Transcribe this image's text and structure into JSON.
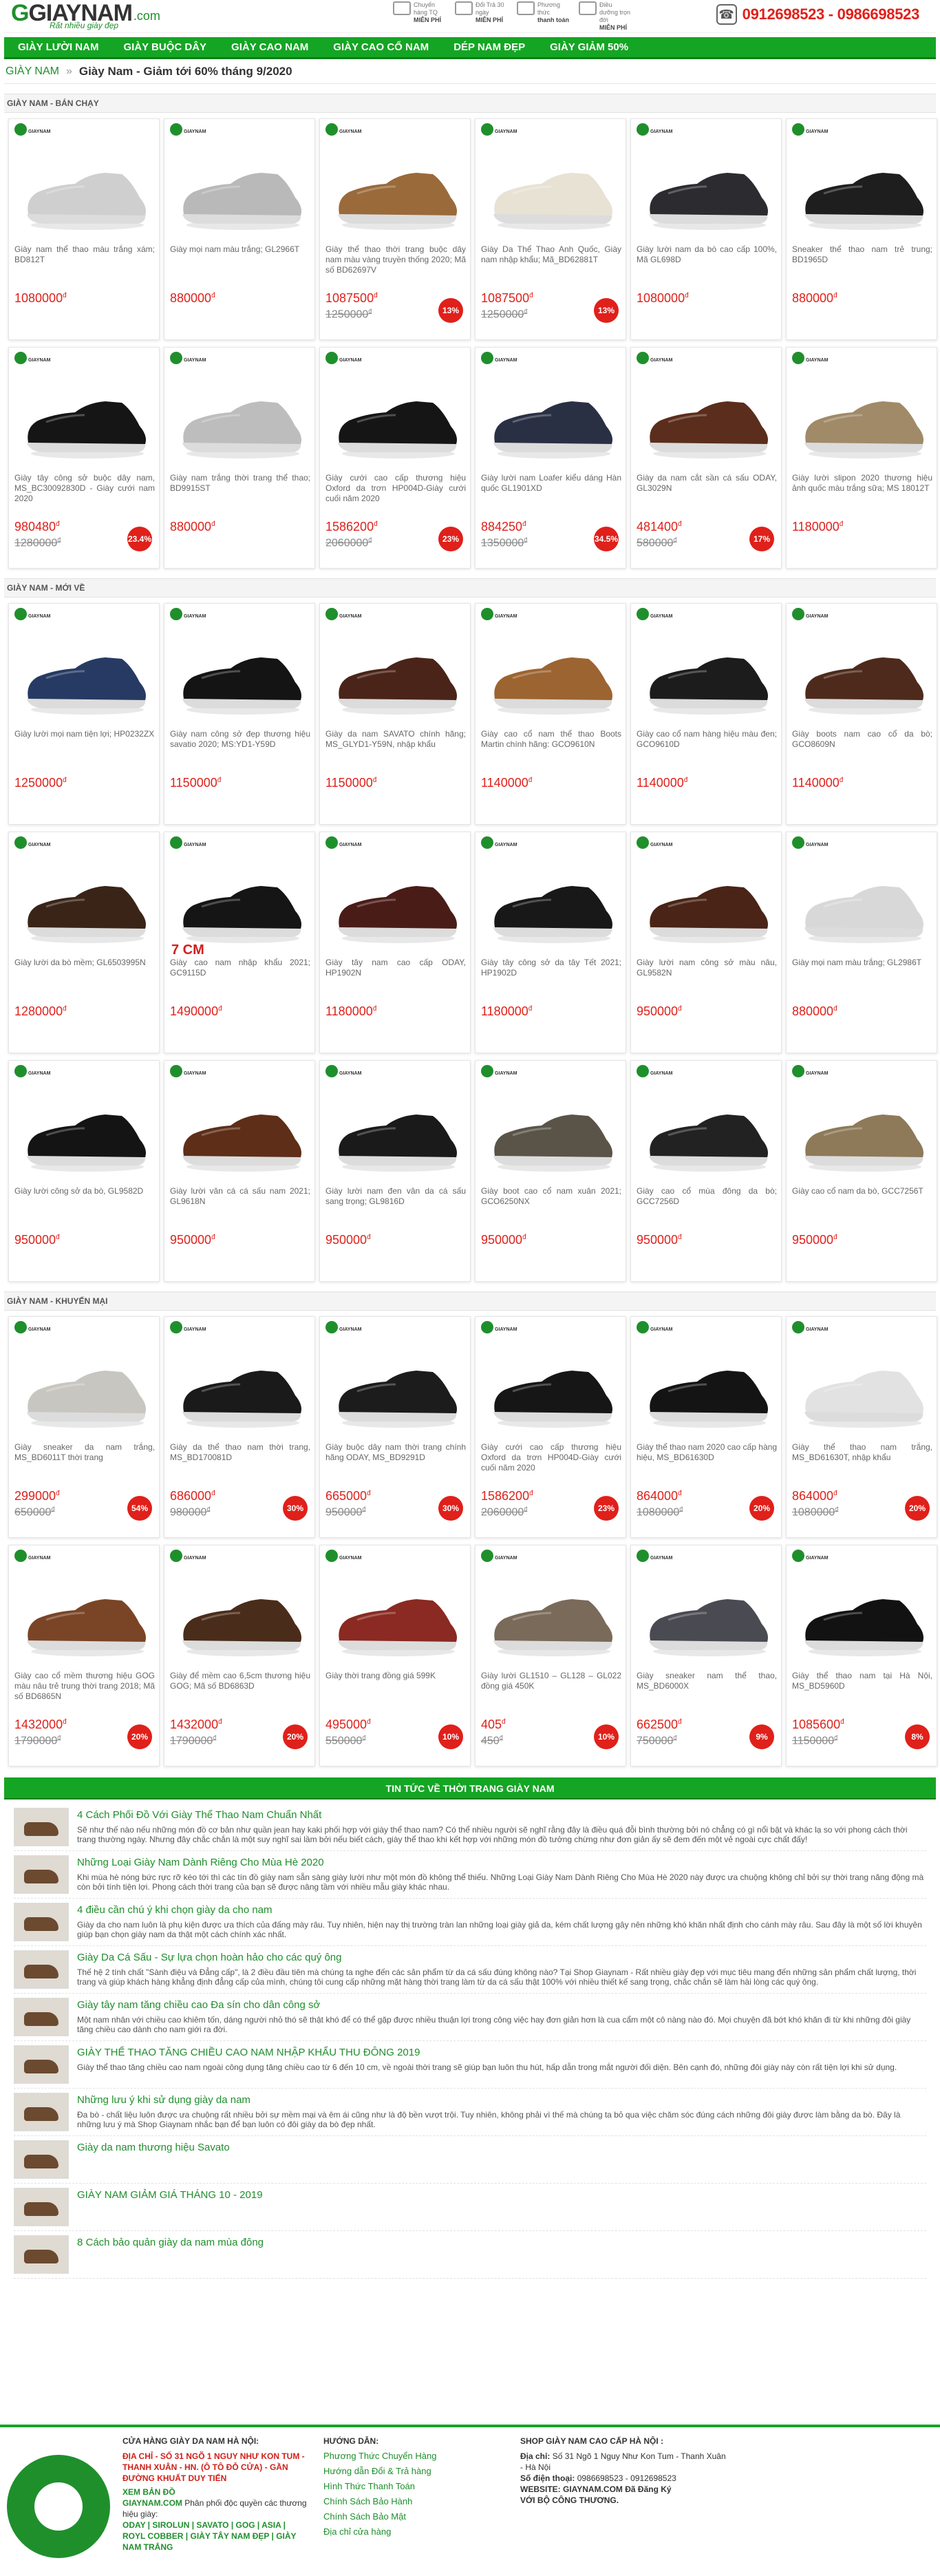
{
  "header": {
    "logo": "GIAYNAM",
    "logo_suffix": ".com",
    "slogan": "Rất nhiều giày đẹp",
    "services": [
      {
        "label": "Chuyển hàng TQ",
        "value": "MIỄN PHÍ"
      },
      {
        "label": "Đổi Trả 30 ngày",
        "value": "MIỄN PHÍ"
      },
      {
        "label": "Phương thức",
        "value": "thanh toán"
      },
      {
        "label": "Điều dưỡng trọn đời",
        "value": "MIỄN PHÍ"
      }
    ],
    "hotline": "0912698523 - 0986698523"
  },
  "nav": [
    "GIÀY LƯỜI NAM",
    "GIÀY BUỘC DÂY",
    "GIÀY CAO NAM",
    "GIÀY CAO CỔ NAM",
    "DÉP NAM ĐẸP",
    "GIÀY GIẢM 50%"
  ],
  "breadcrumb": {
    "home": "GIÀY NAM",
    "sep": "»",
    "current": "Giày Nam - Giảm tới 60% tháng 9/2020"
  },
  "sections": [
    {
      "title": "GIÀY NAM - BÁN CHẠY",
      "products": [
        {
          "name": "Giày nam thể thao màu trắng xám; BD812T",
          "price": "1080000",
          "color": "#cfcfcf"
        },
        {
          "name": "Giày mọi nam màu trắng; GL2966T",
          "price": "880000",
          "color": "#b9b9b9"
        },
        {
          "name": "Giày thể thao thời trang buộc dây nam màu vàng truyền thống 2020; Mã số BD62697V",
          "price": "1087500",
          "old": "1250000",
          "badge": "13%",
          "color": "#9a6a3a"
        },
        {
          "name": "Giày Da Thể Thao Anh Quốc, Giày nam nhập khẩu; Mã_BD62881T",
          "price": "1087500",
          "old": "1250000",
          "badge": "13%",
          "color": "#e8e2d4"
        },
        {
          "name": "Giày lười nam da bò cao cấp 100%, Mã GL698D",
          "price": "1080000",
          "color": "#2b2b30"
        },
        {
          "name": "Sneaker thể thao nam trẻ trung; BD1965D",
          "price": "880000",
          "color": "#1e1e1e"
        },
        {
          "name": "Giày tây công sở buộc dây nam, MS_BC30092830D - Giày cưới nam 2020",
          "price": "980480",
          "old": "1280000",
          "badge": "23.4%",
          "color": "#151515"
        },
        {
          "name": "Giày nam trắng thời trang thể thao; BD9915ST",
          "price": "880000",
          "color": "#bdbdbd"
        },
        {
          "name": "Giày cưới cao cấp thương hiệu Oxford da trơn HP004D-Giày cưới cuối năm 2020",
          "price": "1586200",
          "old": "2060000",
          "badge": "23%",
          "color": "#151515"
        },
        {
          "name": "Giày lười nam Loafer kiểu dáng Hàn quốc GL1901XD",
          "price": "884250",
          "old": "1350000",
          "badge": "34.5%",
          "color": "#2a3044"
        },
        {
          "name": "Giày da nam cắt sần cá sấu ODAY, GL3029N",
          "price": "481400",
          "old": "580000",
          "badge": "17%",
          "color": "#5b2d1c"
        },
        {
          "name": "Giày lười slipon 2020 thương hiệu ảnh quốc màu trắng sữa; MS 18012T",
          "price": "1180000",
          "color": "#a08a68"
        }
      ]
    },
    {
      "title": "GIÀY NAM - MỚI VỀ",
      "products": [
        {
          "name": "Giày lười mọi nam tiện lợi; HP0232ZX",
          "price": "1250000",
          "color": "#263a63"
        },
        {
          "name": "Giày nam công sở đẹp thương hiệu savatio 2020; MS:YD1-Y59D",
          "price": "1150000",
          "color": "#141414"
        },
        {
          "name": "Giày da nam SAVATO chính hãng; MS_GLYD1-Y59N, nhập khẩu",
          "price": "1150000",
          "color": "#4a2418"
        },
        {
          "name": "Giày cao cổ nam thể thao Boots Martin chính hãng: GCO9610N",
          "price": "1140000",
          "color": "#9c6430"
        },
        {
          "name": "Giày cao cổ nam hàng hiệu màu đen; GCO9610D",
          "price": "1140000",
          "color": "#1c1c1c"
        },
        {
          "name": "Giày boots nam cao cổ da bò; GCO8609N",
          "price": "1140000",
          "color": "#4e2a1c"
        },
        {
          "name": "Giày lười da bò mềm; GL6503995N",
          "price": "1280000",
          "color": "#3a2418"
        },
        {
          "name": "Giày cao nam nhập khẩu 2021; GC9115D",
          "price": "1490000",
          "promo": "7 CM",
          "color": "#151515"
        },
        {
          "name": "Giày tây nam cao cấp ODAY, HP1902N",
          "price": "1180000",
          "color": "#4a1c18"
        },
        {
          "name": "Giày tây công sở da tây Tết 2021; HP1902D",
          "price": "1180000",
          "color": "#181818"
        },
        {
          "name": "Giày lười nam công sở màu nâu, GL9582N",
          "price": "950000",
          "color": "#4a2416"
        },
        {
          "name": "Giày mọi nam màu trắng; GL2986T",
          "price": "880000",
          "color": "#d8d8d8"
        },
        {
          "name": "Giày lười công sở da bò, GL9582D",
          "price": "950000",
          "color": "#141414"
        },
        {
          "name": "Giày lười vân cá cá sấu nam 2021; GL9618N",
          "price": "950000",
          "color": "#5e2e18"
        },
        {
          "name": "Giày lười nam đen vân da cá sấu sang trọng; GL9816D",
          "price": "950000",
          "color": "#1a1a1a"
        },
        {
          "name": "Giày boot cao cổ nam xuân 2021; GCO6250NX",
          "price": "950000",
          "color": "#5a5448"
        },
        {
          "name": "Giày cao cổ mùa đông da bò; GCC7256D",
          "price": "950000",
          "color": "#222222"
        },
        {
          "name": "Giày cao cổ nam da bò, GCC7256T",
          "price": "950000",
          "color": "#8e7a58"
        }
      ]
    },
    {
      "title": "GIÀY NAM - KHUYẾN MẠI",
      "products": [
        {
          "name": "Giày sneaker da nam trắng, MS_BD6011T thời trang",
          "price": "299000",
          "old": "650000",
          "badge": "54%",
          "color": "#c8c6c0"
        },
        {
          "name": "Giày da thể thao nam thời trang, MS_BD170081D",
          "price": "686000",
          "old": "980000",
          "badge": "30%",
          "color": "#1a1a1a"
        },
        {
          "name": "Giày buộc dây nam thời trang chính hãng ODAY, MS_BD9291D",
          "price": "665000",
          "old": "950000",
          "badge": "30%",
          "color": "#1c1c1c"
        },
        {
          "name": "Giày cưới cao cấp thương hiệu Oxford da trơn HP004D-Giày cưới cuối năm 2020",
          "price": "1586200",
          "old": "2060000",
          "badge": "23%",
          "color": "#161616"
        },
        {
          "name": "Giày thể thao nam 2020 cao cấp hàng hiệu, MS_BD61630D",
          "price": "864000",
          "old": "1080000",
          "badge": "20%",
          "color": "#141414"
        },
        {
          "name": "Giày thể thao nam trắng, MS_BD61630T, nhập khẩu",
          "price": "864000",
          "old": "1080000",
          "badge": "20%",
          "color": "#e2e2e2"
        },
        {
          "name": "Giày cao cổ mềm thương hiệu GOG màu nâu trẻ trung thời trang 2018; Mã số BD6865N",
          "price": "1432000",
          "old": "1790000",
          "badge": "20%",
          "color": "#7a4526"
        },
        {
          "name": "Giày để mềm cao 6,5cm thương hiệu GOG; Mã số BD6863D",
          "price": "1432000",
          "old": "1790000",
          "badge": "20%",
          "color": "#4a2c1a"
        },
        {
          "name": "Giày thời trang đồng giá 599K",
          "price": "495000",
          "old": "550000",
          "badge": "10%",
          "color": "#8a2a22"
        },
        {
          "name": "Giày lười GL1510 – GL128 – GL022 đồng giá 450K",
          "price": "405",
          "old": "450",
          "badge": "10%",
          "color": "#7a6a5a"
        },
        {
          "name": "Giày sneaker nam thể thao, MS_BD6000X",
          "price": "662500",
          "old": "750000",
          "badge": "9%",
          "color": "#4a4a52"
        },
        {
          "name": "Giày thể thao nam tại Hà Nội, MS_BD5960D",
          "price": "1085600",
          "old": "1150000",
          "badge": "8%",
          "color": "#121212"
        }
      ]
    }
  ],
  "news": {
    "title": "TIN TỨC VỀ THỜI TRANG GIÀY NAM",
    "items": [
      {
        "title": "4 Cách Phối Đồ Với Giày Thể Thao Nam Chuẩn Nhất",
        "desc": "Sẽ như thế nào nếu những món đồ cơ bản như quần jean hay kaki phối hợp với giày thể thao nam? Có thể nhiều người sẽ nghĩ rằng đây là điều quá đỗi bình thường bởi nó chẳng có gì nổi bật và khác lạ so với phong cách thời trang thường ngày. Nhưng đây chắc chắn là một suy nghĩ sai lầm bởi nếu biết cách, giày thể thao khi kết hợp với những món đồ tưởng chừng như đơn giản ấy sẽ đem đến một vẻ ngoài cực chất đấy!"
      },
      {
        "title": "Những Loại Giày Nam Dành Riêng Cho Mùa Hè 2020",
        "desc": "Khi mùa hè nóng bức rực rỡ kéo tới thì các tín đồ giày nam sẵn sàng giày lười như một món đồ không thể thiếu. Những Loại Giày Nam Dành Riêng Cho Mùa Hè 2020 này được ưa chuộng không chỉ bởi sự thời trang năng động mà còn bởi tính tiện lợi. Phong cách thời trang của bạn sẽ được nâng tầm với nhiều mẫu giày khác nhau."
      },
      {
        "title": "4 điều cần chú ý khi chọn giày da cho nam",
        "desc": "Giày da cho nam luôn là phụ kiện được ưa thích của đấng mày râu. Tuy nhiên, hiện nay thị trường tràn lan những loại giày giả da, kém chất lượng gây nên những khó khăn nhất định cho cánh mày râu. Sau đây là một số lời khuyên giúp bạn chọn giày nam da thật một cách chính xác nhất."
      },
      {
        "title": "Giày Da Cá Sấu - Sự lựa chọn hoàn hảo cho các quý ông",
        "desc": "Thế hệ 2 tính chất \"Sành điệu và Đẳng cấp\", là 2 điều đầu tiên mà chúng ta nghe đến các sản phẩm từ da cá sấu đúng không nào? Tại Shop Giaynam - Rất nhiều giày đẹp với mục tiêu mang đến những sản phẩm chất lượng, thời trang và giúp khách hàng khẳng định đẳng cấp của mình, chúng tôi cung cấp những mặt hàng thời trang làm từ da cá sấu thật 100% với nhiều thiết kế sang trọng, chắc chắn sẽ làm hài lòng các quý ông."
      },
      {
        "title": "Giày tây nam tăng chiều cao Đa sín cho dân công sở",
        "desc": "Một nam nhân với chiều cao khiêm tốn, dáng người nhỏ thó sẽ thật khó để có thể gặp được nhiều thuận lợi trong công việc hay đơn giản hơn là cua cẩm một cô nàng nào đó. Mọi chuyện đã bớt khó khăn đi từ khi những đôi giày tăng chiều cao dành cho nam giới ra đời."
      },
      {
        "title": "GIÀY THỂ THAO TĂNG CHIỀU CAO NAM NHẬP KHẨU THU ĐÔNG 2019",
        "desc": "Giày thể thao tăng chiều cao nam ngoài công dụng tăng chiều cao từ 6 đến 10 cm, về ngoài thời trang sẽ giúp bạn luôn thu hút, hấp dẫn trong mắt người đối diện. Bên cạnh đó, những đôi giày này còn rất tiện lợi khi sử dụng."
      },
      {
        "title": "Những lưu ý khi sử dụng giày da nam",
        "desc": "Đa bò - chất liệu luôn được ưa chuộng rất nhiều bởi sự mềm mại và êm ái cũng như là độ bền vượt trội. Tuy nhiên, không phải vì thế mà chúng ta bỏ qua việc chăm sóc đúng cách những đôi giày được làm bằng da bò. Đây là những lưu ý mà Shop Giaynam nhắc bạn để bạn luôn có đôi giày da bò đẹp nhất."
      },
      {
        "title": "Giày da nam thương hiệu Savato",
        "desc": ""
      },
      {
        "title": "GIÀY NAM GIẢM GIÁ THÁNG 10 - 2019",
        "desc": ""
      },
      {
        "title": "8 Cách bảo quản giày da nam mùa đông",
        "desc": ""
      }
    ]
  },
  "footer": {
    "store": {
      "heading": "CỬA HÀNG GIÀY DA NAM HÀ NỘI:",
      "address_label": "ĐỊA CHỈ",
      "address": "- SỐ 31 NGÕ 1 NGUY NHƯ KON TUM - THANH XUÂN - HN. (Ô TÔ ĐỖ CỬA) - GẦN ĐƯỜNG KHUẤT DUY TIẾN",
      "map": "XEM BẢN ĐỒ",
      "site": "GIAYNAM.COM",
      "site_desc": "Phân phối độc quyền các thương hiệu giày:",
      "brands": "ODAY | SIROLUN | SAVATO | GOG | ASIA | ROYL COBBER | GIÀY TÂY NAM ĐẸP | GIÀY NAM TRẮNG"
    },
    "guide": {
      "heading": "HƯỚNG DẪN:",
      "links": [
        "Phương Thức Chuyển Hàng",
        "Hướng dẫn Đổi & Trả hàng",
        "Hình Thức Thanh Toán",
        "Chính Sách Bảo Hành",
        "Chính Sách Bảo Mật",
        "Địa chỉ cửa hàng"
      ]
    },
    "shop": {
      "heading": "SHOP GIÀY NAM CAO CẤP HÀ NỘI :",
      "address_label": "Địa chỉ:",
      "address": "Số 31 Ngõ 1 Nguy Như Kon Tum - Thanh Xuân - Hà Nội",
      "phone_label": "Số điện thoại:",
      "phone": "0986698523 - 0912698523",
      "web_label": "WEBSITE:",
      "web": "GIAYNAM.COM Đã Đăng Ký",
      "partner": "VỚI BỘ CÔNG THƯƠNG."
    }
  }
}
